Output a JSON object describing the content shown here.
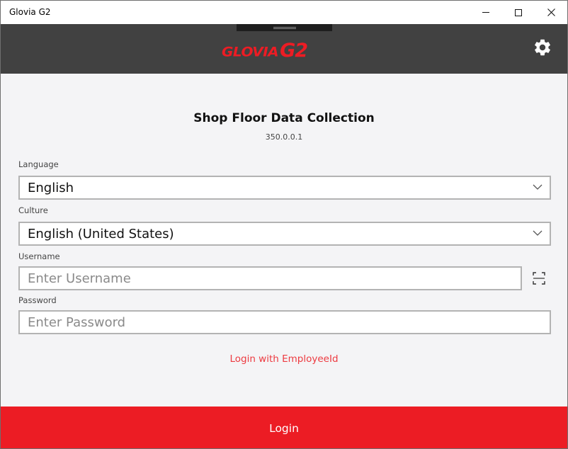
{
  "window": {
    "title": "Glovia G2",
    "controls": {
      "minimize": "minimize-icon",
      "maximize": "maximize-icon",
      "close": "close-icon"
    }
  },
  "header": {
    "logo_text": "GLOVIA",
    "logo_suffix": "G2",
    "settings_icon": "gear-icon"
  },
  "main": {
    "title": "Shop Floor Data Collection",
    "version": "350.0.0.1",
    "language": {
      "label": "Language",
      "value": "English"
    },
    "culture": {
      "label": "Culture",
      "value": "English (United States)"
    },
    "username": {
      "label": "Username",
      "placeholder": "Enter Username",
      "value": "",
      "scan_icon": "barcode-scan-icon"
    },
    "password": {
      "label": "Password",
      "placeholder": "Enter Password",
      "value": ""
    },
    "employee_link": "Login with EmployeeId",
    "login_button": "Login"
  },
  "colors": {
    "accent": "#ec1c24",
    "header_bg": "#414141",
    "content_bg": "#f4f4f6",
    "link": "#ed3a40"
  }
}
